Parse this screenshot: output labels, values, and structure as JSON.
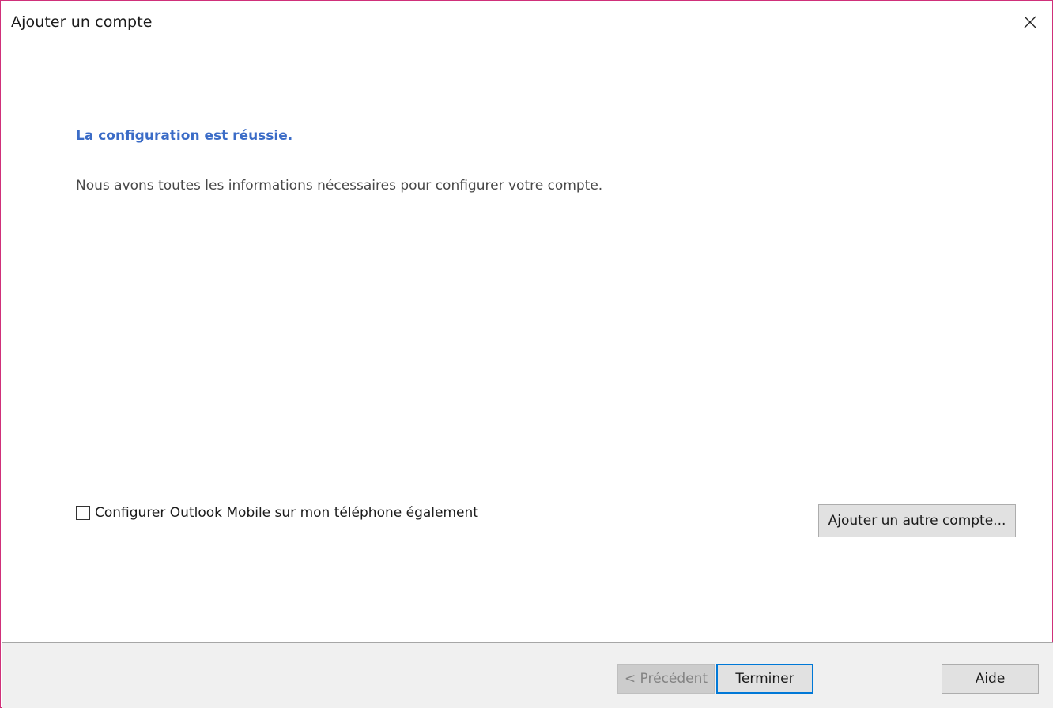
{
  "window": {
    "title": "Ajouter un compte",
    "close_icon": "close-icon"
  },
  "content": {
    "heading": "La configuration est réussie.",
    "message": "Nous avons toutes les informations nécessaires pour configurer votre compte.",
    "mobile_checkbox": {
      "label": "Configurer Outlook Mobile sur mon téléphone également",
      "checked": false
    },
    "add_another_label": "Ajouter un autre compte..."
  },
  "footer": {
    "prev_label": "< Précédent",
    "prev_enabled": false,
    "finish_label": "Terminer",
    "help_label": "Aide"
  },
  "colors": {
    "accent": "#0078d7",
    "heading": "#3b6cc7",
    "window_border": "#d0307a"
  }
}
